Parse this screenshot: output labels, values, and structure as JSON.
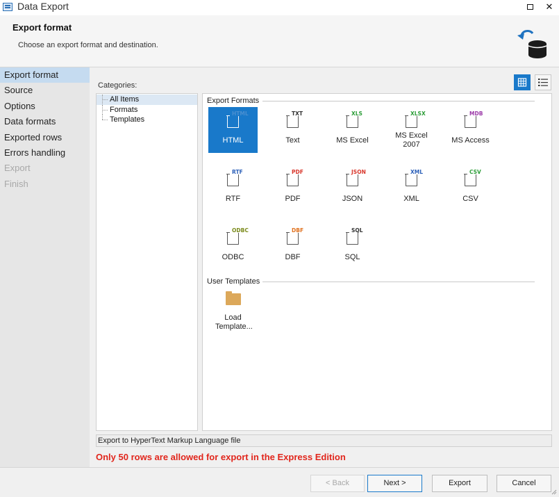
{
  "window": {
    "title": "Data Export",
    "maximize_label": "",
    "close_label": "✕"
  },
  "header": {
    "title": "Export format",
    "subtitle": "Choose an export format and destination."
  },
  "sidebar": {
    "items": [
      {
        "label": "Export format",
        "state": "active"
      },
      {
        "label": "Source",
        "state": "normal"
      },
      {
        "label": "Options",
        "state": "normal"
      },
      {
        "label": "Data formats",
        "state": "normal"
      },
      {
        "label": "Exported rows",
        "state": "normal"
      },
      {
        "label": "Errors handling",
        "state": "normal"
      },
      {
        "label": "Export",
        "state": "disabled"
      },
      {
        "label": "Finish",
        "state": "disabled"
      }
    ]
  },
  "categories": {
    "label": "Categories:",
    "items": [
      "All Items",
      "Formats",
      "Templates"
    ],
    "selected": "All Items"
  },
  "view_toggle": {
    "active": "grid"
  },
  "groups": {
    "export_formats": "Export Formats",
    "user_templates": "User Templates"
  },
  "formats": [
    {
      "name": "HTML",
      "tag": "HTML",
      "tag_color": "#4a8fd0",
      "selected": true
    },
    {
      "name": "Text",
      "tag": "TXT",
      "tag_color": "#333333"
    },
    {
      "name": "MS Excel",
      "tag": "XLS",
      "tag_color": "#2e9e3a"
    },
    {
      "name": "MS Excel 2007",
      "tag": "XLSX",
      "tag_color": "#2e9e3a"
    },
    {
      "name": "MS Access",
      "tag": "MDB",
      "tag_color": "#9b3aa8"
    },
    {
      "name": "RTF",
      "tag": "RTF",
      "tag_color": "#2b5fb8"
    },
    {
      "name": "PDF",
      "tag": "PDF",
      "tag_color": "#d8362b"
    },
    {
      "name": "JSON",
      "tag": "JSON",
      "tag_color": "#d8362b"
    },
    {
      "name": "XML",
      "tag": "XML",
      "tag_color": "#2b5fb8"
    },
    {
      "name": "CSV",
      "tag": "CSV",
      "tag_color": "#2e9e3a"
    },
    {
      "name": "ODBC",
      "tag": "ODBC",
      "tag_color": "#7a8a1a"
    },
    {
      "name": "DBF",
      "tag": "DBF",
      "tag_color": "#e0701c"
    },
    {
      "name": "SQL",
      "tag": "SQL",
      "tag_color": "#333333"
    }
  ],
  "templates": [
    {
      "name": "Load Template...",
      "icon": "folder-icon"
    }
  ],
  "status": "Export to HyperText Markup Language file",
  "warning": "Only 50 rows are allowed for export in the Express Edition",
  "footer": {
    "back": "< Back",
    "next": "Next >",
    "export": "Export",
    "cancel": "Cancel"
  }
}
